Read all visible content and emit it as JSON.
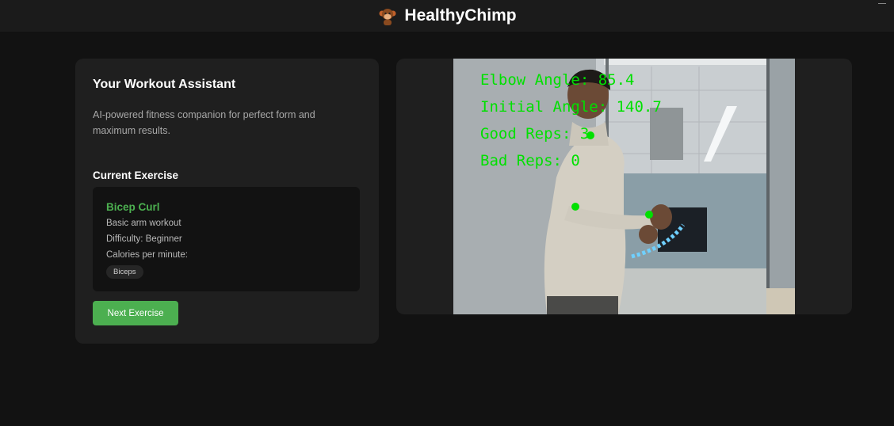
{
  "app": {
    "title": "HealthyChimp",
    "logo_icon": "monkey-icon"
  },
  "assistant": {
    "title": "Your Workout Assistant",
    "description": "AI-powered fitness companion for perfect form and maximum results.",
    "current_exercise_label": "Current Exercise",
    "exercise": {
      "name": "Bicep Curl",
      "subtitle": "Basic arm workout",
      "difficulty": "Difficulty: Beginner",
      "calories": "Calories per minute:",
      "tag": "Biceps"
    },
    "next_button": "Next Exercise"
  },
  "camera_overlay": {
    "elbow_angle": "Elbow Angle: 85.4",
    "initial_angle": "Initial Angle: 140.7",
    "good_reps": "Good Reps: 3",
    "bad_reps": "Bad Reps: 0"
  },
  "colors": {
    "accent_green": "#4caf50",
    "overlay_green": "#00e000",
    "background": "#121212",
    "card": "#1f1f1f"
  }
}
